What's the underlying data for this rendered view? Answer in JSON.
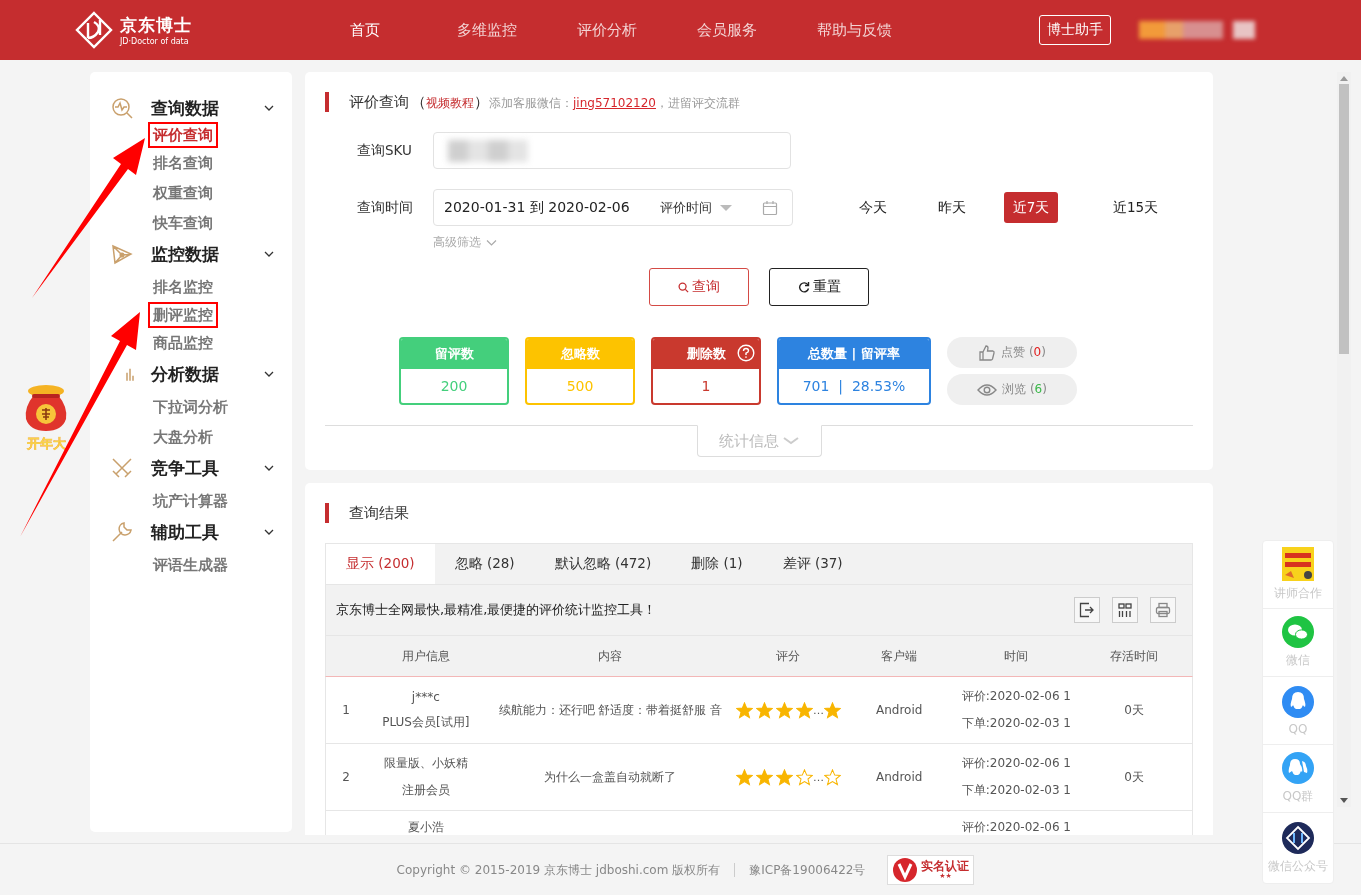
{
  "header": {
    "logo_title": "京东博士",
    "logo_subtitle": "JD·Doctor of data",
    "nav": [
      {
        "label": "首页",
        "selected": true
      },
      {
        "label": "多维监控",
        "selected": false
      },
      {
        "label": "评价分析",
        "selected": false
      },
      {
        "label": "会员服务",
        "selected": false
      },
      {
        "label": "帮助与反馈",
        "selected": false
      }
    ],
    "assistant_button": "博士助手"
  },
  "promo": {
    "label": "开年大"
  },
  "sidebar": {
    "groups": [
      {
        "title": "查询数据",
        "kind": "pulse",
        "expanded": true,
        "children": [
          {
            "label": "评价查询",
            "selected": true,
            "annotated": true
          },
          {
            "label": "排名查询",
            "selected": false,
            "annotated": false
          },
          {
            "label": "权重查询",
            "selected": false,
            "annotated": false
          },
          {
            "label": "快车查询",
            "selected": false,
            "annotated": false
          }
        ]
      },
      {
        "title": "监控数据",
        "kind": "network",
        "expanded": true,
        "children": [
          {
            "label": "排名监控",
            "selected": false,
            "annotated": false
          },
          {
            "label": "删评监控",
            "selected": false,
            "annotated": true
          },
          {
            "label": "商品监控",
            "selected": false,
            "annotated": false
          }
        ]
      },
      {
        "title": "分析数据",
        "kind": "bars",
        "expanded": true,
        "children": [
          {
            "label": "下拉词分析",
            "selected": false,
            "annotated": false
          },
          {
            "label": "大盘分析",
            "selected": false,
            "annotated": false
          }
        ]
      },
      {
        "title": "竞争工具",
        "kind": "swords",
        "expanded": true,
        "children": [
          {
            "label": "坑产计算器",
            "selected": false,
            "annotated": false
          }
        ]
      },
      {
        "title": "辅助工具",
        "kind": "wrench",
        "expanded": true,
        "children": [
          {
            "label": "评语生成器",
            "selected": false,
            "annotated": false
          }
        ]
      }
    ]
  },
  "query": {
    "heading": {
      "title": "评价查询",
      "open_paren": "（",
      "tutorial_link": "视频教程",
      "close_paren": "）",
      "note_prefix": "添加客服微信：",
      "wechat_link": "jing57102120",
      "note_suffix": "，进留评交流群"
    },
    "sku": {
      "label": "查询SKU"
    },
    "time": {
      "label": "查询时间",
      "range": "2020-01-31 到 2020-02-06",
      "type_select": "评价时间"
    },
    "quick_ranges": [
      {
        "label": "今天",
        "selected": false
      },
      {
        "label": "昨天",
        "selected": false
      },
      {
        "label": "近7天",
        "selected": true
      },
      {
        "label": "近15天",
        "selected": false
      }
    ],
    "advanced_filter": "高级筛选",
    "search_button": "查询",
    "reset_button": "重置",
    "stats": [
      {
        "title": "留评数",
        "value": "200",
        "color": "#44cf7c",
        "help": false
      },
      {
        "title": "忽略数",
        "value": "500",
        "color": "#fdc300",
        "help": false
      },
      {
        "title": "删除数",
        "value": "1",
        "color": "#c9392e",
        "help": true
      },
      {
        "title": "总数量 | 留评率",
        "value": "701  |  28.53%",
        "color": "#2d83e0",
        "help": false
      }
    ],
    "reactions": [
      {
        "kind": "like",
        "label": "点赞",
        "before": "(",
        "count": "0",
        "after": ")",
        "color": "#e02020"
      },
      {
        "kind": "view",
        "label": "浏览",
        "before": "(",
        "count": "6",
        "after": ")",
        "color": "#3bb84a"
      }
    ],
    "stats_toggle": {
      "label": "统计信息",
      "expanded": false
    }
  },
  "results": {
    "title": "查询结果",
    "tabs": [
      {
        "label": "显示 (200)",
        "selected": true
      },
      {
        "label": "忽略 (28)",
        "selected": false
      },
      {
        "label": "默认忽略 (472)",
        "selected": false
      },
      {
        "label": "删除 (1)",
        "selected": false
      },
      {
        "label": "差评 (37)",
        "selected": false
      }
    ],
    "slogan": "京东博士全网最快,最精准,最便捷的评价统计监控工具！",
    "columns": [
      "用户信息",
      "内容",
      "评分",
      "客户端",
      "时间",
      "存活时间"
    ],
    "rows": [
      {
        "index": "1",
        "user": "j***c",
        "member": "PLUS会员[试用]",
        "content": "续航能力：还行吧 舒适度：带着挺舒服 音",
        "stars": 5,
        "ellipsis": "…",
        "client": "Android",
        "review_time": "评价:2020-02-06 1",
        "order_time": "下单:2020-02-03 1",
        "survival": "0天"
      },
      {
        "index": "2",
        "user": "限量版、小妖精",
        "member": "注册会员",
        "content": "为什么一盒盖自动就断了",
        "stars": 3,
        "ellipsis": "…",
        "client": "Android",
        "review_time": "评价:2020-02-06 1",
        "order_time": "下单:2020-02-03 1",
        "survival": "0天"
      },
      {
        "user": "夏小浩",
        "review_time": "评价:2020-02-06 1"
      }
    ]
  },
  "float_panel": [
    {
      "kind": "lecturer",
      "label": "讲师合作"
    },
    {
      "kind": "wechat",
      "label": "微信"
    },
    {
      "kind": "qq",
      "label": "QQ"
    },
    {
      "kind": "qq_group",
      "label": "QQ群"
    },
    {
      "kind": "official",
      "label": "微信公众号"
    }
  ],
  "footer": {
    "copyright": "Copyright © 2015-2019 京东博士 jdboshi.com 版权所有",
    "icp": "豫ICP备19006422号",
    "badge": "实名认证",
    "badge_stars": "★★"
  }
}
